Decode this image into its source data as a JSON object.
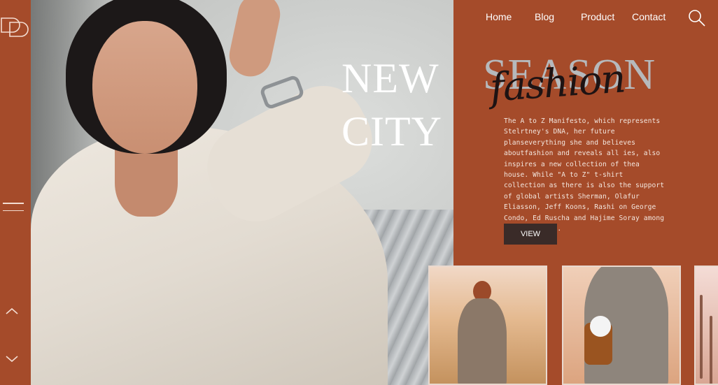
{
  "nav": {
    "items": [
      "Home",
      "Blog",
      "Product",
      "Contact"
    ]
  },
  "icons": {
    "logo": "dp-logo",
    "menu": "hamburger-menu-icon",
    "up": "chevron-up-icon",
    "down": "chevron-down-icon",
    "search": "search-icon"
  },
  "hero": {
    "line1": "NEW",
    "line2": "CITY"
  },
  "feature": {
    "season": "SEASON",
    "fashion": "fashion",
    "description": "The A to Z Manifesto, which represents Stelrtney's DNA, her future planseverything she and believes aboutfashion and reveals all ies, also inspires a new collection of  thea house. While \"A to Z\" t-shirt collection as there is also the support of global artists Sherman, Olafur Eliasson, Jeff Koons, Rashi on George Condo, Ed Ruscha and Hajime Soray among these artists.",
    "button": "VIEW"
  },
  "colors": {
    "background": "#a54b2a",
    "button": "#3a2b28",
    "season_text": "#b6b9bc",
    "script_text": "#1e1313"
  }
}
